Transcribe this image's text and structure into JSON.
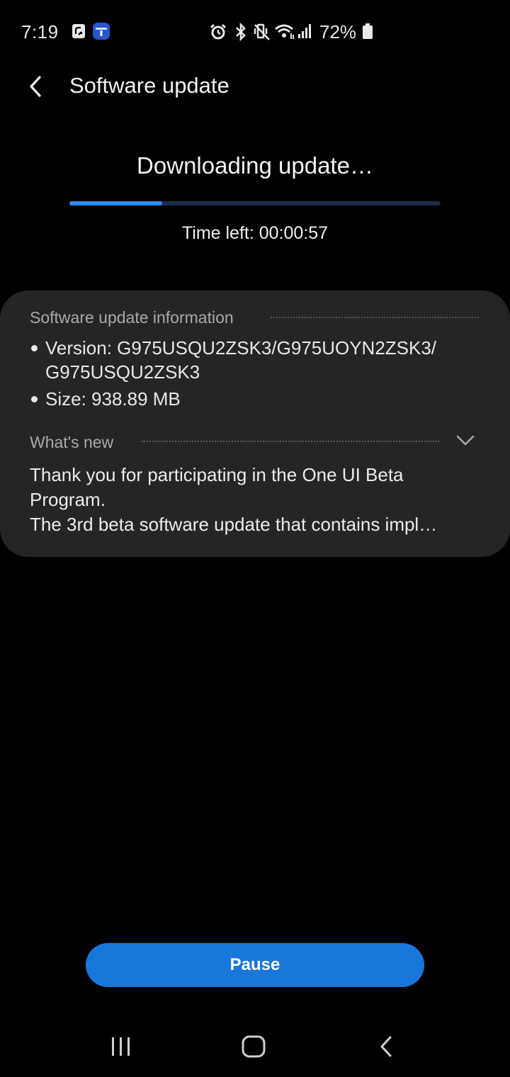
{
  "status_bar": {
    "time": "7:19",
    "battery_percent": "72%",
    "icons": [
      "nfc-icon",
      "samsung-notification-icon",
      "alarm-icon",
      "bluetooth-icon",
      "vibrate-mute-icon",
      "wifi-icon",
      "cell-signal-icon",
      "battery-icon"
    ]
  },
  "header": {
    "back_icon": "chevron-left-icon",
    "title": "Software update"
  },
  "download": {
    "status": "Downloading update…",
    "progress_fraction": 0.25,
    "progress_color": "#2f8cf0",
    "track_color": "#1b2d4a",
    "time_left_label": "Time left:",
    "time_left_value": "00:00:57"
  },
  "info": {
    "heading": "Software update information",
    "version_line1": "Version: G975USQU2ZSK3/G975UOYN2ZSK3/",
    "version_line2": "G975USQU2ZSK3",
    "size": "Size: 938.89 MB"
  },
  "whats_new": {
    "heading": "What's new",
    "line1": "Thank you for participating in the One UI Beta",
    "line2": "Program.",
    "line3": "The 3rd beta software update that contains impl…",
    "expand_icon": "chevron-down-icon"
  },
  "actions": {
    "pause_label": "Pause",
    "accent_color": "#1877db"
  },
  "nav": {
    "recents_icon": "recents-icon",
    "home_icon": "home-icon",
    "back_icon": "back-icon"
  }
}
